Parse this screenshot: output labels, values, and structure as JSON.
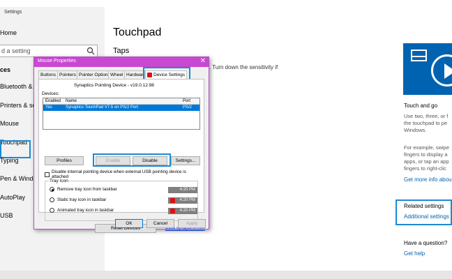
{
  "app": {
    "title": "Settings"
  },
  "sidebar": {
    "home": "Home",
    "search_placeholder": "d a setting",
    "section": "ces",
    "items": [
      {
        "label": "Bluetooth & o"
      },
      {
        "label": "Printers & sca"
      },
      {
        "label": "Mouse"
      },
      {
        "label": "Touchpad"
      },
      {
        "label": "Typing"
      },
      {
        "label": "Pen & Windo"
      },
      {
        "label": "AutoPlay"
      },
      {
        "label": "USB"
      }
    ]
  },
  "main": {
    "title": "Touchpad",
    "taps_heading": "Taps",
    "taps_text": ". Turn down the sensitivity if",
    "touch_and_go": "Touch and go",
    "desc1_lines": [
      "Use two, three, or f",
      "the touchpad to pe",
      "Windows."
    ],
    "desc2_lines": [
      "For example, swipe",
      "fingers to display a",
      "apps, or tap an app",
      "fingers to right-clic"
    ],
    "more_link": "Get more info abou",
    "related_heading": "Related settings",
    "related_link": "Additional settings",
    "question_heading": "Have a question?",
    "help_link": "Get help"
  },
  "dialog": {
    "title": "Mouse Properties",
    "close": "✕",
    "tabs": [
      "Buttons",
      "Pointers",
      "Pointer Options",
      "Wheel",
      "Hardware",
      "Device Settings"
    ],
    "driver": "Synaptics Pointing Device - v19.0.12.98",
    "devices_label": "Devices:",
    "columns": [
      "Enabled",
      "Name",
      "Port"
    ],
    "row": {
      "enabled": "Yes",
      "name": "Synaptics TouchPad V7.5 on PS/2 Port",
      "port": "PS/2"
    },
    "buttons": {
      "profiles": "Profiles",
      "enable": "Enable",
      "disable": "Disable",
      "settings": "Settings..."
    },
    "checkbox": "Disable internal pointing device when external USB pointing device is attached",
    "tray_label": "Tray Icon",
    "tray_options": [
      "Remove tray icon from taskbar",
      "Static tray icon in taskbar",
      "Animated tray icon in taskbar"
    ],
    "time": "4:20 PM",
    "reset": "Reset Devices",
    "link": "www.synaptics.com",
    "ok": "OK",
    "cancel": "Cancel",
    "apply": "Apply"
  },
  "colors": {
    "accent": "#0063b1",
    "highlight": "#1a8ad4",
    "dialog_title": "#c948d0"
  }
}
